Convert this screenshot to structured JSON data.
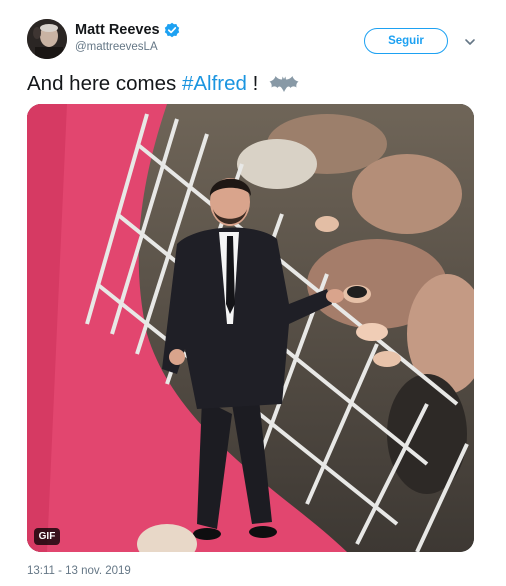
{
  "tweet": {
    "author": {
      "display_name": "Matt Reeves",
      "handle": "@mattreevesLA",
      "verified_icon": "verified-badge-icon"
    },
    "follow_label": "Seguir",
    "text_before": "And here comes ",
    "hashtag": "#Alfred",
    "text_after": " ! ",
    "emoji": "bat-emoji-icon",
    "media": {
      "badge": "GIF"
    },
    "timestamp": "13:11 - 13 nov. 2019"
  },
  "colors": {
    "link_blue": "#1b95e0",
    "button_blue": "#1da1f2",
    "text": "#14171a",
    "secondary_text": "#657786",
    "red_carpet": "#e2466f"
  }
}
